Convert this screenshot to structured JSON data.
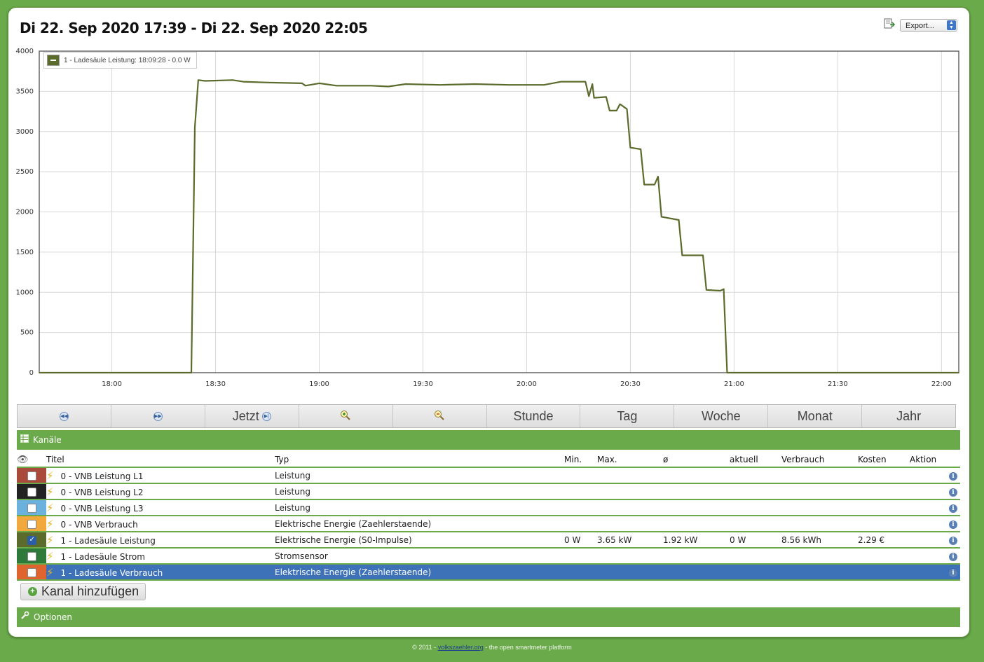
{
  "header": {
    "title": "Di 22. Sep 2020 17:39 - Di 22. Sep 2020 22:05",
    "export_label": "Export..."
  },
  "chart_legend": "1 - Ladesäule Leistung: 18:09:28 - 0.0 W",
  "chart_data": {
    "type": "line",
    "title": "",
    "xlabel": "",
    "ylabel": "",
    "x_ticks": [
      "18:00",
      "18:30",
      "19:00",
      "19:30",
      "20:00",
      "20:30",
      "21:00",
      "21:30",
      "22:00"
    ],
    "y_ticks": [
      "0",
      "500",
      "1000",
      "1500",
      "2000",
      "2500",
      "3000",
      "3500",
      "4000"
    ],
    "ylim": [
      0,
      4000
    ],
    "xlim": [
      "17:39",
      "22:05"
    ],
    "grid": true,
    "legend": "top-left",
    "line_color": "#5a6b2c",
    "series": [
      {
        "name": "1 - Ladesäule Leistung",
        "points": [
          [
            "17:39",
            0
          ],
          [
            "18:23",
            0
          ],
          [
            "18:24",
            3050
          ],
          [
            "18:25",
            3640
          ],
          [
            "18:27",
            3630
          ],
          [
            "18:35",
            3640
          ],
          [
            "18:38",
            3620
          ],
          [
            "18:45",
            3610
          ],
          [
            "18:55",
            3600
          ],
          [
            "18:56",
            3570
          ],
          [
            "19:00",
            3600
          ],
          [
            "19:05",
            3570
          ],
          [
            "19:15",
            3570
          ],
          [
            "19:20",
            3560
          ],
          [
            "19:25",
            3590
          ],
          [
            "19:35",
            3580
          ],
          [
            "19:45",
            3590
          ],
          [
            "19:55",
            3580
          ],
          [
            "20:05",
            3580
          ],
          [
            "20:10",
            3620
          ],
          [
            "20:17",
            3620
          ],
          [
            "20:18",
            3440
          ],
          [
            "20:19",
            3590
          ],
          [
            "20:19.5",
            3420
          ],
          [
            "20:23",
            3430
          ],
          [
            "20:24",
            3260
          ],
          [
            "20:26",
            3260
          ],
          [
            "20:27",
            3340
          ],
          [
            "20:29",
            3280
          ],
          [
            "20:30",
            2800
          ],
          [
            "20:33",
            2780
          ],
          [
            "20:34",
            2340
          ],
          [
            "20:37",
            2340
          ],
          [
            "20:38",
            2440
          ],
          [
            "20:39",
            1940
          ],
          [
            "20:44",
            1900
          ],
          [
            "20:45",
            1460
          ],
          [
            "20:51",
            1460
          ],
          [
            "20:52",
            1030
          ],
          [
            "20:56",
            1020
          ],
          [
            "20:57",
            1040
          ],
          [
            "20:58",
            0
          ],
          [
            "22:05",
            0
          ]
        ]
      }
    ]
  },
  "toolbar": {
    "buttons": [
      {
        "label": "",
        "icon": "rewind-icon"
      },
      {
        "label": "",
        "icon": "forward-icon"
      },
      {
        "label": "Jetzt",
        "icon": "skip-end-icon"
      },
      {
        "label": "",
        "icon": "zoom-in-icon"
      },
      {
        "label": "",
        "icon": "zoom-out-icon"
      },
      {
        "label": "Stunde"
      },
      {
        "label": "Tag"
      },
      {
        "label": "Woche"
      },
      {
        "label": "Monat"
      },
      {
        "label": "Jahr"
      }
    ]
  },
  "channels": {
    "section_title": "Kanäle",
    "columns": [
      "Titel",
      "Typ",
      "Min.",
      "Max.",
      "ø",
      "aktuell",
      "Verbrauch",
      "Kosten",
      "Aktion"
    ],
    "rows": [
      {
        "color": "#a94a3a",
        "checked": false,
        "title": "0 - VNB Leistung L1",
        "type": "Leistung",
        "min": "",
        "max": "",
        "avg": "",
        "current": "",
        "consumption": "",
        "cost": ""
      },
      {
        "color": "#222222",
        "checked": false,
        "title": "0 - VNB Leistung L2",
        "type": "Leistung",
        "min": "",
        "max": "",
        "avg": "",
        "current": "",
        "consumption": "",
        "cost": ""
      },
      {
        "color": "#6ab1de",
        "checked": false,
        "title": "0 - VNB Leistung L3",
        "type": "Leistung",
        "min": "",
        "max": "",
        "avg": "",
        "current": "",
        "consumption": "",
        "cost": ""
      },
      {
        "color": "#f0a93a",
        "checked": false,
        "title": "0 - VNB Verbrauch",
        "type": "Elektrische Energie (Zaehlerstaende)",
        "min": "",
        "max": "",
        "avg": "",
        "current": "",
        "consumption": "",
        "cost": ""
      },
      {
        "color": "#5a6b2c",
        "checked": true,
        "title": "1 - Ladesäule Leistung",
        "type": "Elektrische Energie (S0-Impulse)",
        "min": "0 W",
        "max": "3.65 kW",
        "avg": "1.92 kW",
        "current": "0 W",
        "consumption": "8.56 kWh",
        "cost": "2.29 €"
      },
      {
        "color": "#2d7a3a",
        "checked": false,
        "title": "1 - Ladesäule Strom",
        "type": "Stromsensor",
        "min": "",
        "max": "",
        "avg": "",
        "current": "",
        "consumption": "",
        "cost": ""
      },
      {
        "color": "#e0642e",
        "checked": false,
        "title": "1 - Ladesäule Verbrauch",
        "type": "Elektrische Energie (Zaehlerstaende)",
        "min": "",
        "max": "",
        "avg": "",
        "current": "",
        "consumption": "",
        "cost": "",
        "selected": true
      }
    ],
    "add_button": "Kanal hinzufügen"
  },
  "options": {
    "section_title": "Optionen"
  },
  "footer": {
    "prefix": "© 2011 - ",
    "link": "volkszaehler.org",
    "suffix": " - the open smartmeter platform"
  }
}
